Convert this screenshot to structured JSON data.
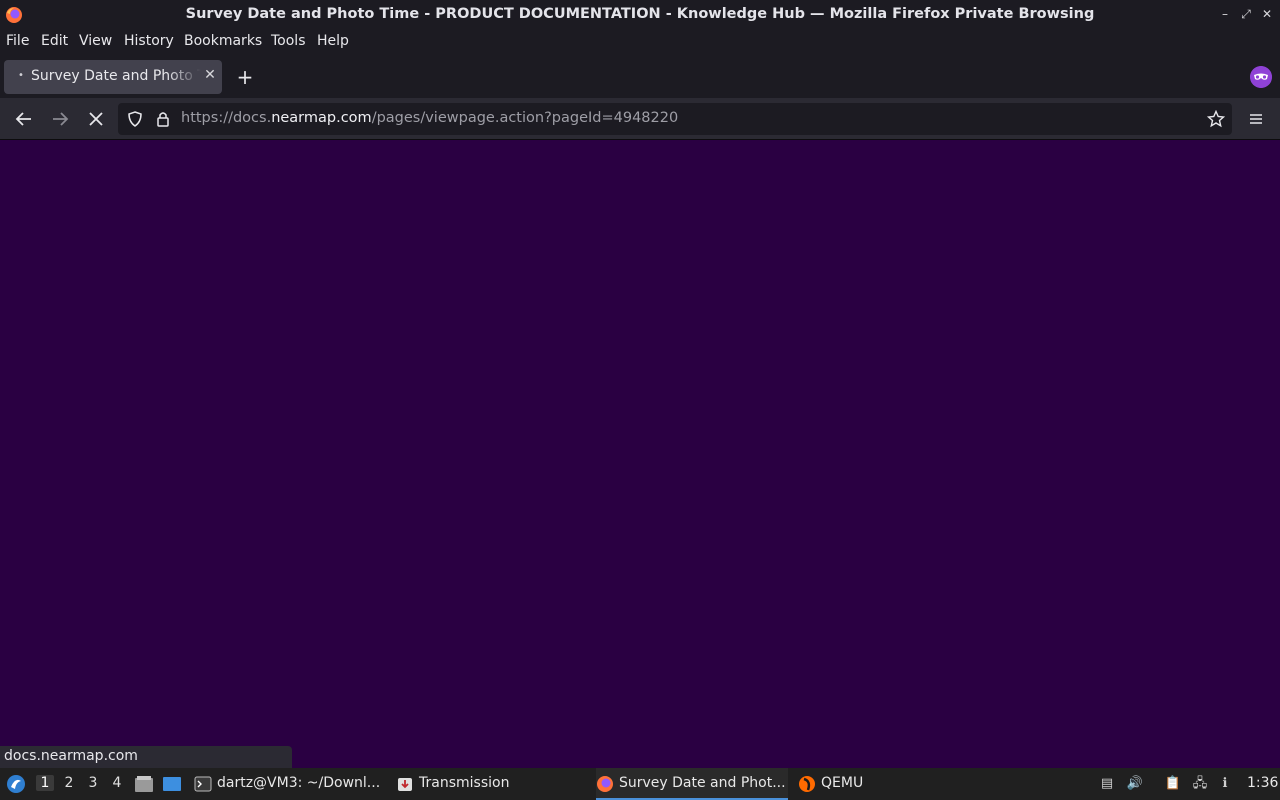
{
  "window": {
    "title": "Survey Date and Photo Time - PRODUCT DOCUMENTATION - Knowledge Hub — Mozilla Firefox Private Browsing"
  },
  "menu": {
    "file": "File",
    "edit": "Edit",
    "view": "View",
    "history": "History",
    "bookmarks": "Bookmarks",
    "tools": "Tools",
    "help": "Help"
  },
  "tab": {
    "label": "Survey Date and Photo Time - PRODUCT DOCUMENTATION"
  },
  "url": {
    "scheme": "https://docs.",
    "host": "nearmap.com",
    "path": "/pages/viewpage.action?pageId=4948220"
  },
  "status": {
    "text": "docs.nearmap.com"
  },
  "taskbar": {
    "workspaces": [
      "1",
      "2",
      "3",
      "4"
    ],
    "tasks": [
      {
        "label": "dartz@VM3: ~/Downl..."
      },
      {
        "label": "Transmission"
      },
      {
        "label": "Survey Date and Phot..."
      },
      {
        "label": "QEMU"
      }
    ],
    "clock": "1:36"
  },
  "colors": {
    "page_background": "#2a0042",
    "private_accent": "#8f42d6"
  }
}
